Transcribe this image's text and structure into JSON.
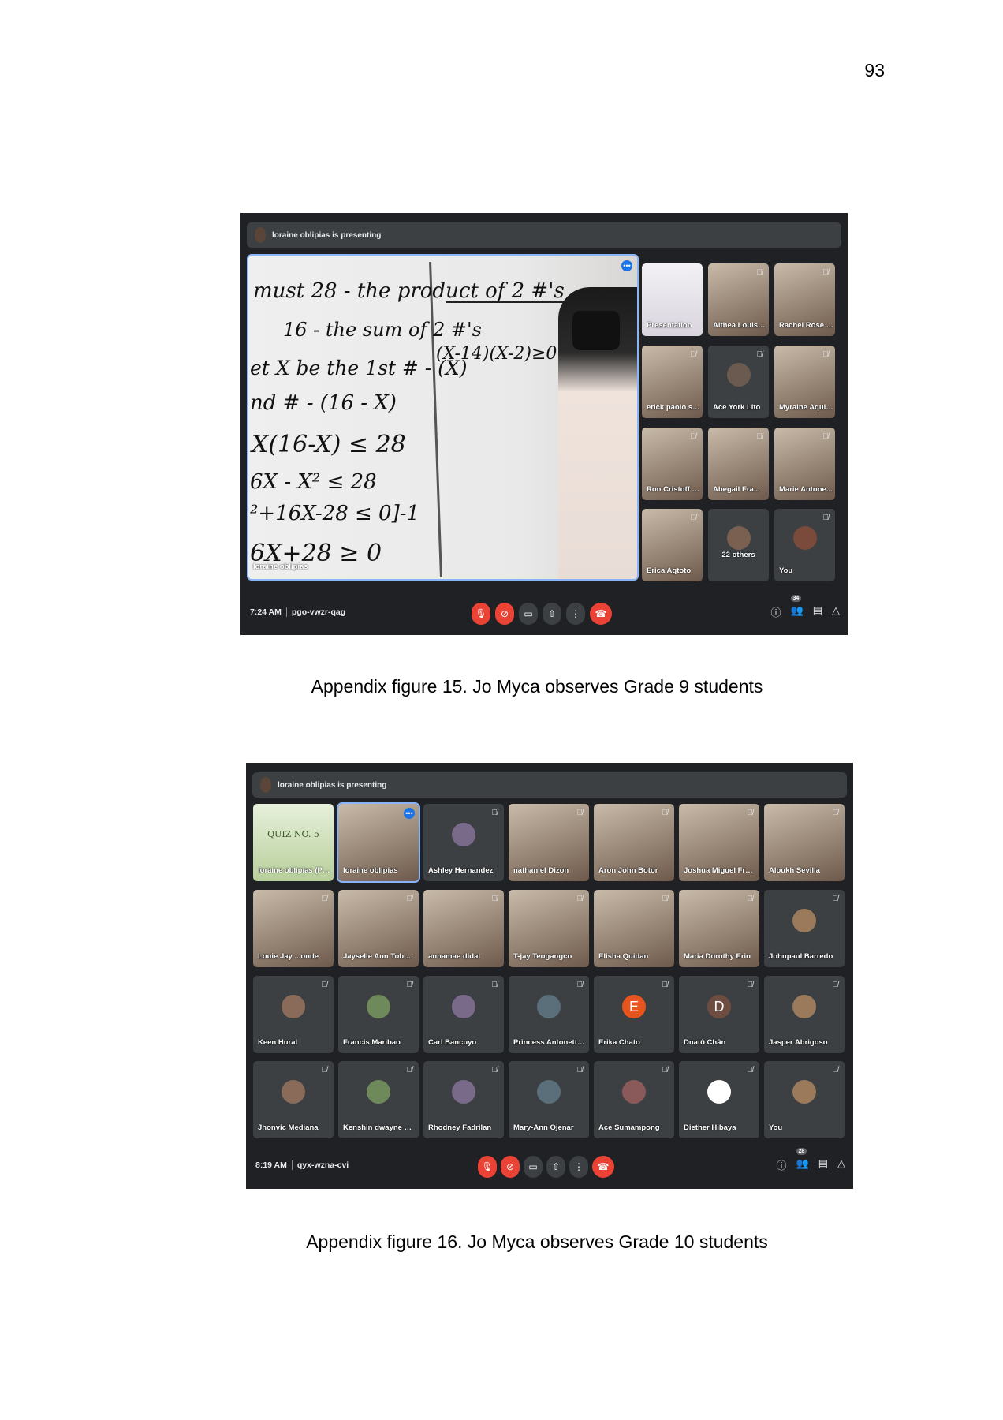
{
  "page_number": "93",
  "figure1": {
    "caption": "Appendix figure 15. Jo Myca observes Grade 9 students",
    "presenting": "loraine oblipias is presenting",
    "presenter_label": "loraine oblipias",
    "board_lines": [
      "must 28 - the product of 2 #'s",
      "16 - the sum of 2 #'s",
      "et X be the 1st # - (X)",
      "nd # - (16 - X)",
      "X(16-X) ≤ 28",
      "6X - X² ≤ 28",
      "²+16X-28 ≤ 0]-1",
      "6X+28 ≥ 0",
      "(X-14)(X-2)≥0"
    ],
    "tiles": [
      {
        "name": "Presentation"
      },
      {
        "name": "Althea Louise ..."
      },
      {
        "name": "Rachel Rose N..."
      },
      {
        "name": "erick paolo sa..."
      },
      {
        "name": "Ace York Lito"
      },
      {
        "name": "Myraine Aquino"
      },
      {
        "name": "Ron Cristoff L..."
      },
      {
        "name": "Abegail Fra..."
      },
      {
        "name": "Marie Antone..."
      },
      {
        "name": "Erica Agtoto"
      },
      {
        "name": "22 others"
      },
      {
        "name": "You"
      }
    ],
    "time": "7:24 AM",
    "meeting_code": "pgo-vwzr-qag",
    "participant_count": "34"
  },
  "figure2": {
    "caption": "Appendix figure 16. Jo Myca observes Grade 10 students",
    "presenting": "loraine oblipias is presenting",
    "tiles": [
      {
        "name": "loraine oblipias (Presentation)"
      },
      {
        "name": "loraine oblipias"
      },
      {
        "name": "Ashley Hernandez"
      },
      {
        "name": "nathaniel Dizon"
      },
      {
        "name": "Aron John Botor"
      },
      {
        "name": "Joshua Miguel Franc..."
      },
      {
        "name": "Aloukh Sevilla"
      },
      {
        "name": "Louie Jay ...onde"
      },
      {
        "name": "Jayselle Ann Tobias..."
      },
      {
        "name": "annamae didal"
      },
      {
        "name": "T-jay Teogangco"
      },
      {
        "name": "Elisha Quidan"
      },
      {
        "name": "Maria Dorothy Erio"
      },
      {
        "name": "Johnpaul Barredo"
      },
      {
        "name": "Keen Hural"
      },
      {
        "name": "Francis Maribao"
      },
      {
        "name": "Carl Bancuyo"
      },
      {
        "name": "Princess Antonette Si..."
      },
      {
        "name": "Erika Chato",
        "initial": "E"
      },
      {
        "name": "Dnatô Chân",
        "initial": "D"
      },
      {
        "name": "Jasper Abrigoso"
      },
      {
        "name": "Jhonvic Mediana"
      },
      {
        "name": "Kenshin dwayne Guar..."
      },
      {
        "name": "Rhodney Fadrilan"
      },
      {
        "name": "Mary-Ann Ojenar"
      },
      {
        "name": "Ace Sumampong"
      },
      {
        "name": "Diether Hibaya"
      },
      {
        "name": "You"
      }
    ],
    "slide_title": "QUIZ NO. 5",
    "time": "8:19 AM",
    "meeting_code": "qyx-wzna-cvi",
    "participant_count": "28"
  },
  "colors": {
    "meet_bg": "#202124",
    "tile_bg": "#3c4043",
    "red": "#ea4335",
    "accent": "#8ab4f8"
  }
}
